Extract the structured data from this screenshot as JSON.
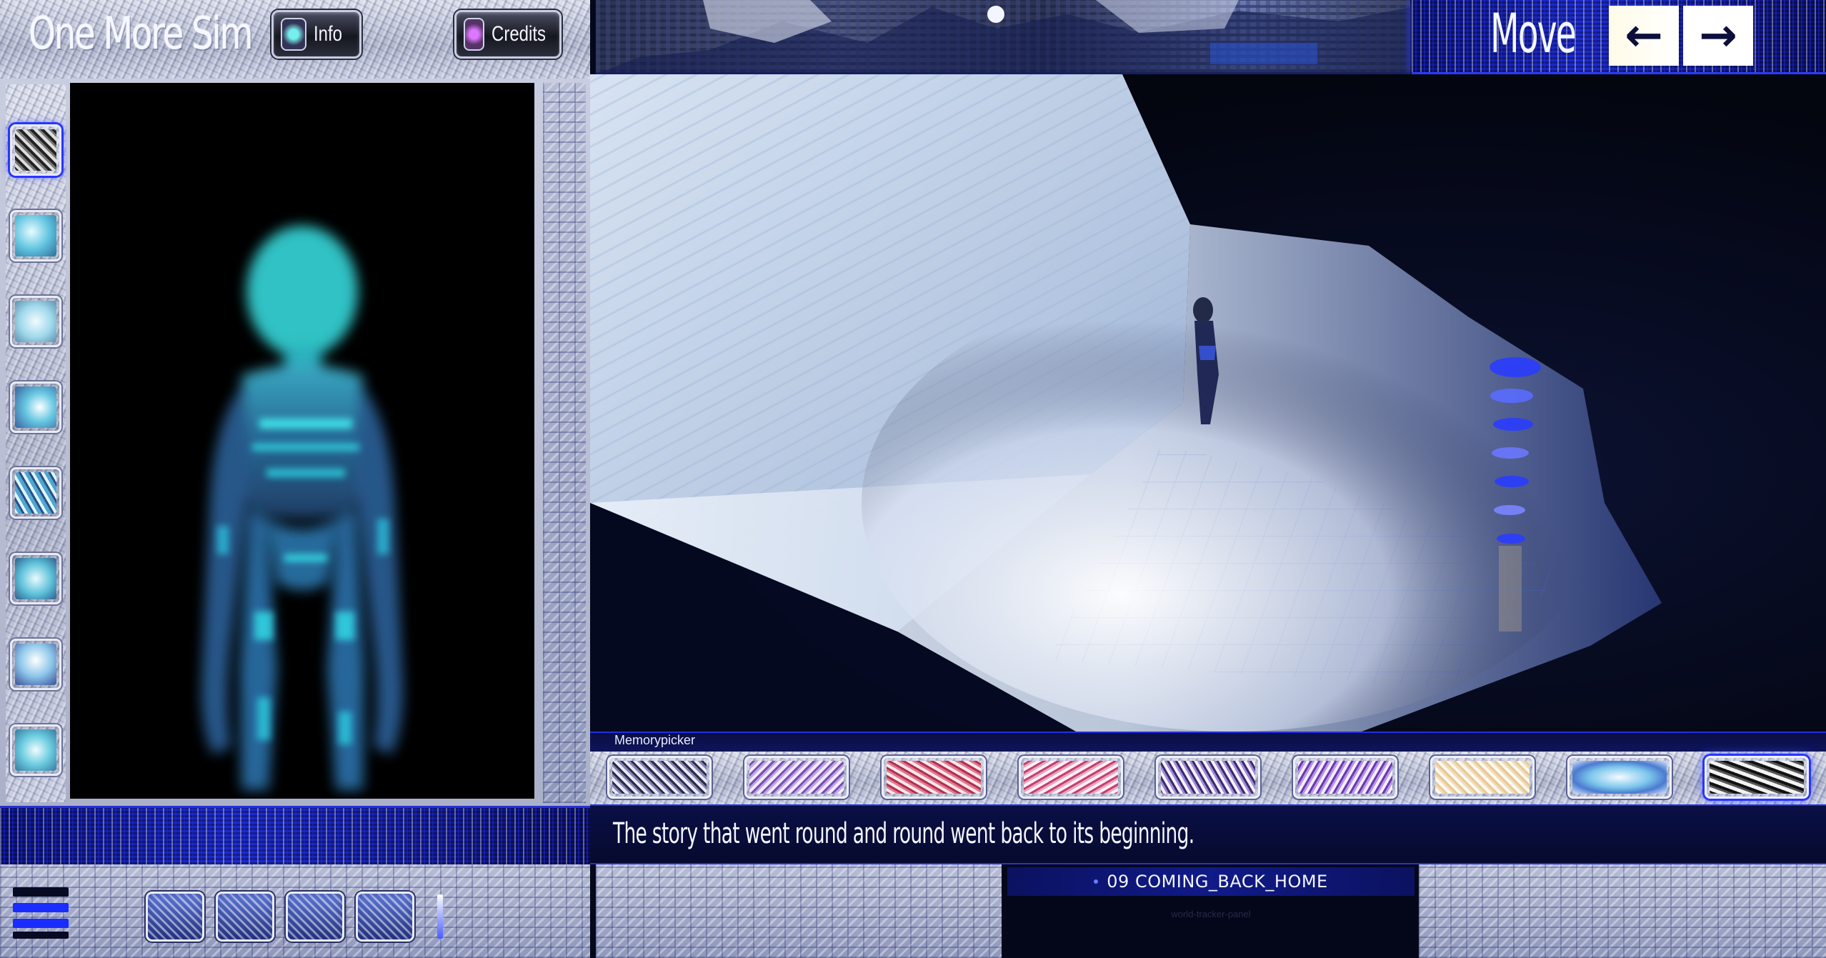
{
  "header": {
    "app_title": "One More Sim",
    "info_label": "Info",
    "credits_label": "Credits"
  },
  "outfits": {
    "count": 8,
    "selected_index": 0
  },
  "move": {
    "label": "Move",
    "left_arrow": "←",
    "right_arrow": "→"
  },
  "memorypicker": {
    "label": "Memorypicker",
    "count": 9,
    "selected_index": 8
  },
  "story": {
    "text": "The story that went round and round went back to its beginning."
  },
  "world": {
    "name": "09 COMING_BACK_HOME",
    "tracker": "world-tracker-panel"
  },
  "colors": {
    "accent": "#2836ff",
    "panel_dark": "#060a2e",
    "character": "#2fd6e0"
  }
}
